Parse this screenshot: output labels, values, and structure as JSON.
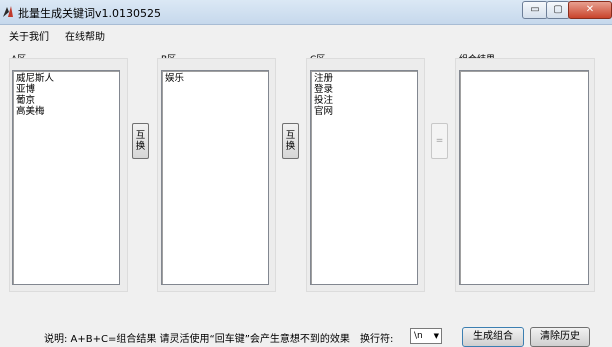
{
  "window": {
    "title": "批量生成关键词v1.0130525",
    "controls": {
      "minimize": "▭",
      "maximize": "▢",
      "close": "✕"
    }
  },
  "menu": {
    "about": "关于我们",
    "help": "在线帮助"
  },
  "panels": {
    "a": {
      "label": "A区",
      "items": [
        "威尼斯人",
        "亚博",
        "葡京",
        "高美梅"
      ]
    },
    "b": {
      "label": "B区",
      "items": [
        "娱乐"
      ]
    },
    "c": {
      "label": "C区",
      "items": [
        "注册",
        "登录",
        "投注",
        "官网"
      ]
    },
    "result": {
      "label": "组合结果",
      "items": []
    }
  },
  "buttons": {
    "swap": "互换",
    "equals": "="
  },
  "footer": {
    "explain": "说明:  A+B+C=组合结果  请灵活使用“回车键”会产生意想不到的效果",
    "linebreak_label": "换行符:",
    "linebreak_value": "\\n",
    "generate": "生成组合",
    "clear": "清除历史"
  }
}
